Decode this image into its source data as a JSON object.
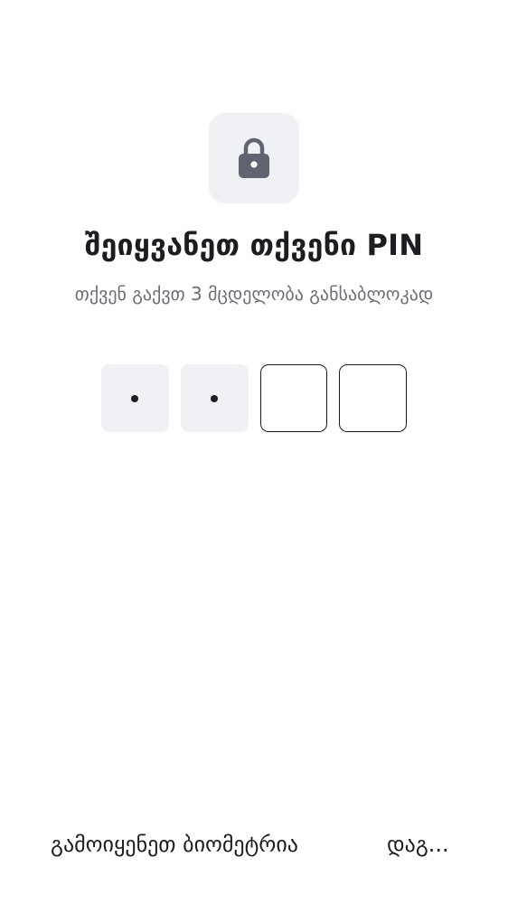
{
  "header": {
    "icon": "lock-icon",
    "title": "შეიყვანეთ თქვენი PIN",
    "subtitle": "თქვენ გაქვთ 3 მცდელობა განსაბლოკად"
  },
  "pin": {
    "length": 4,
    "filled_count": 2,
    "cells": [
      {
        "state": "filled",
        "mask": "•"
      },
      {
        "state": "filled",
        "mask": "•"
      },
      {
        "state": "empty",
        "mask": ""
      },
      {
        "state": "empty",
        "mask": ""
      }
    ]
  },
  "actions": {
    "biometrics_label": "გამოიყენეთ ბიომეტრია",
    "forgot_label": "დაგ..."
  },
  "colors": {
    "background": "#ffffff",
    "tile": "#f0f1f5",
    "icon": "#5f6470",
    "text_primary": "#1c1d21",
    "text_secondary": "#6b6e76"
  }
}
